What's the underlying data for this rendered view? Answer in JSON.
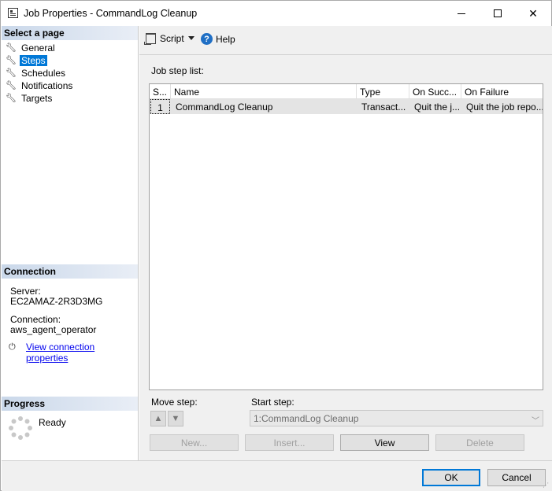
{
  "window": {
    "title": "Job Properties - CommandLog Cleanup"
  },
  "left_panel": {
    "select_page_header": "Select a page",
    "pages": [
      {
        "label": "General",
        "selected": false
      },
      {
        "label": "Steps",
        "selected": true
      },
      {
        "label": "Schedules",
        "selected": false
      },
      {
        "label": "Notifications",
        "selected": false
      },
      {
        "label": "Targets",
        "selected": false
      }
    ],
    "connection_header": "Connection",
    "server_label": "Server:",
    "server_value": "EC2AMAZ-2R3D3MG",
    "connection_label": "Connection:",
    "connection_value": "aws_agent_operator",
    "view_connection_link": "View connection properties",
    "progress_header": "Progress",
    "progress_status": "Ready"
  },
  "toolbar": {
    "script_label": "Script",
    "help_label": "Help"
  },
  "steps": {
    "list_label": "Job step list:",
    "columns": [
      "S...",
      "Name",
      "Type",
      "On Succ...",
      "On Failure"
    ],
    "rows": [
      {
        "step": "1",
        "name": "CommandLog Cleanup",
        "type": "Transact...",
        "on_success": "Quit the j...",
        "on_failure": "Quit the job repo..."
      }
    ],
    "move_step_label": "Move step:",
    "start_step_label": "Start step:",
    "start_step_value": "1:CommandLog Cleanup",
    "buttons": {
      "new": "New...",
      "insert": "Insert...",
      "view": "View",
      "delete": "Delete"
    }
  },
  "dialog": {
    "ok": "OK",
    "cancel": "Cancel"
  },
  "colors": {
    "selection": "#0078d7",
    "link": "#0000ee",
    "header_gradient_start": "#cad8ea"
  }
}
